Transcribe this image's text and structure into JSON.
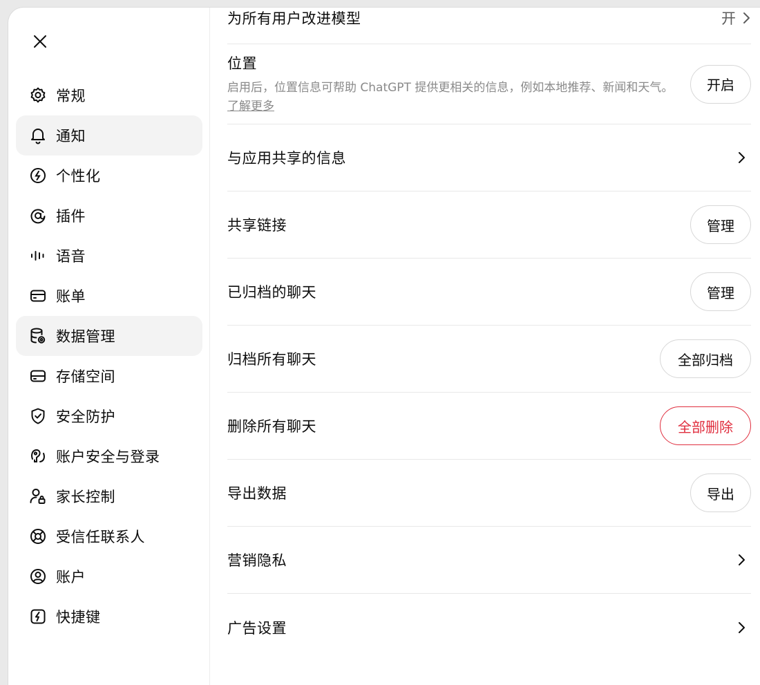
{
  "sidebar": {
    "close_icon": "close-icon",
    "items": [
      {
        "label": "常规",
        "icon": "gear-icon"
      },
      {
        "label": "通知",
        "icon": "bell-icon",
        "active": true
      },
      {
        "label": "个性化",
        "icon": "personalize-icon"
      },
      {
        "label": "插件",
        "icon": "plugin-icon"
      },
      {
        "label": "语音",
        "icon": "waveform-icon"
      },
      {
        "label": "账单",
        "icon": "card-icon"
      },
      {
        "label": "数据管理",
        "icon": "database-gear-icon",
        "active": true
      },
      {
        "label": "存储空间",
        "icon": "storage-icon"
      },
      {
        "label": "安全防护",
        "icon": "shield-icon"
      },
      {
        "label": "账户安全与登录",
        "icon": "key-icon"
      },
      {
        "label": "家长控制",
        "icon": "parent-lock-icon"
      },
      {
        "label": "受信任联系人",
        "icon": "lifebuoy-icon"
      },
      {
        "label": "账户",
        "icon": "user-circle-icon"
      },
      {
        "label": "快捷键",
        "icon": "bolt-icon"
      }
    ]
  },
  "content": {
    "improve_model": {
      "title": "为所有用户改进模型",
      "value": "开"
    },
    "location": {
      "title": "位置",
      "description": "启用后，位置信息可帮助 ChatGPT 提供更相关的信息，例如本地推荐、新闻和天气。",
      "link": "了解更多",
      "button": "开启"
    },
    "app_sharing": {
      "title": "与应用共享的信息"
    },
    "shared_links": {
      "title": "共享链接",
      "button": "管理"
    },
    "archived_chats": {
      "title": "已归档的聊天",
      "button": "管理"
    },
    "archive_all": {
      "title": "归档所有聊天",
      "button": "全部归档"
    },
    "delete_all": {
      "title": "删除所有聊天",
      "button": "全部删除"
    },
    "export_data": {
      "title": "导出数据",
      "button": "导出"
    },
    "marketing_privacy": {
      "title": "营销隐私"
    },
    "ad_settings": {
      "title": "广告设置"
    }
  },
  "colors": {
    "danger": "#e02e3e",
    "active_bg": "#f3f3f3",
    "muted": "#8a8a8a"
  }
}
